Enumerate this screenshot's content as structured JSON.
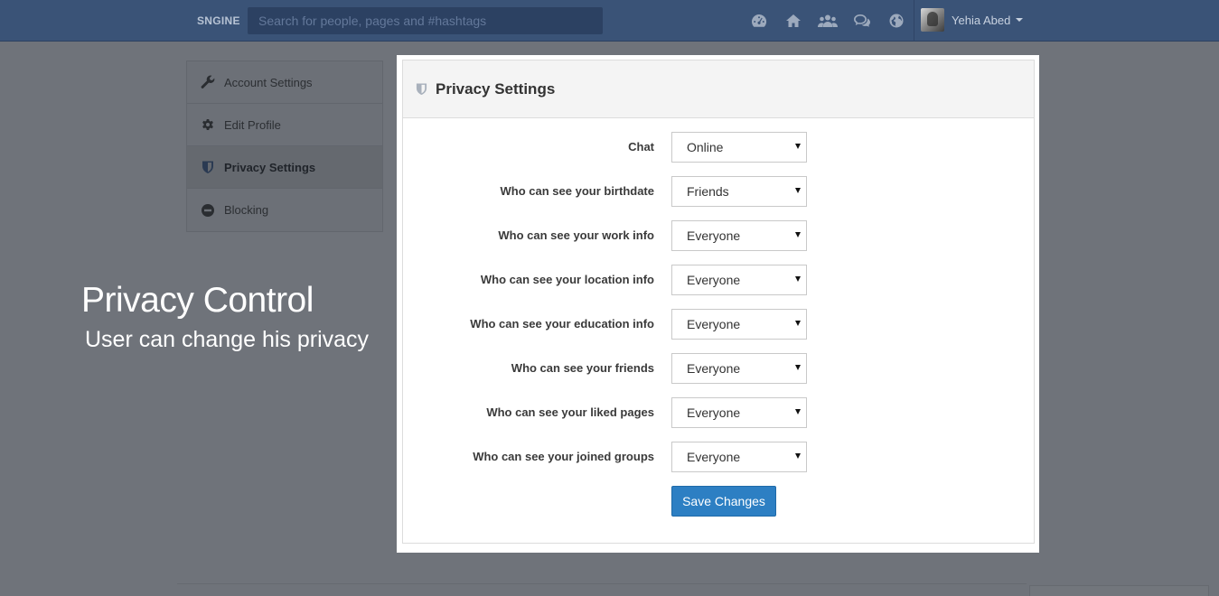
{
  "nav": {
    "brand": "SNGINE",
    "search_placeholder": "Search for people, pages and #hashtags",
    "icons": [
      "dashboard-icon",
      "home-icon",
      "users-icon",
      "messages-icon",
      "globe-icon"
    ],
    "user_name": "Yehia Abed"
  },
  "sidebar": {
    "items": [
      {
        "label": "Account Settings",
        "icon": "wrench-icon"
      },
      {
        "label": "Edit Profile",
        "icon": "gear-icon"
      },
      {
        "label": "Privacy Settings",
        "icon": "shield-icon",
        "active": true
      },
      {
        "label": "Blocking",
        "icon": "minus-circle-icon"
      }
    ]
  },
  "promo": {
    "title": "Privacy Control",
    "subtitle": "User can change his privacy"
  },
  "panel": {
    "title": "Privacy Settings",
    "rows": [
      {
        "label": "Chat",
        "value": "Online"
      },
      {
        "label": "Who can see your birthdate",
        "value": "Friends"
      },
      {
        "label": "Who can see your work info",
        "value": "Everyone"
      },
      {
        "label": "Who can see your location info",
        "value": "Everyone"
      },
      {
        "label": "Who can see your education info",
        "value": "Everyone"
      },
      {
        "label": "Who can see your friends",
        "value": "Everyone"
      },
      {
        "label": "Who can see your liked pages",
        "value": "Everyone"
      },
      {
        "label": "Who can see your joined groups",
        "value": "Everyone"
      }
    ],
    "save_label": "Save Changes"
  },
  "colors": {
    "navbar": "#3a5377",
    "overlay_bg": "#6f737a",
    "primary_button": "#2d7fc3"
  }
}
